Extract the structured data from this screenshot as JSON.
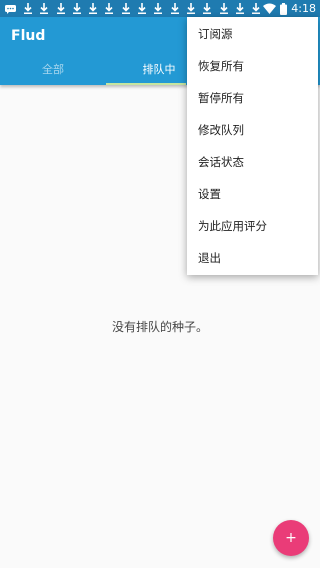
{
  "status_bar": {
    "time": "4:18",
    "left_icons": [
      "message-icon",
      "download-icon",
      "download-icon",
      "download-icon",
      "download-icon",
      "download-icon",
      "download-icon",
      "download-icon",
      "download-icon",
      "download-icon",
      "download-icon",
      "download-icon",
      "download-icon",
      "download-icon",
      "download-icon",
      "download-icon"
    ],
    "right_icons": [
      "wifi-icon",
      "battery-icon"
    ]
  },
  "app_bar": {
    "title": "Flud",
    "tabs": [
      {
        "label": "全部"
      },
      {
        "label": "排队中"
      }
    ],
    "active_tab": 1,
    "color": "#2399d4"
  },
  "empty_state": {
    "text": "没有排队的种子。"
  },
  "overflow_menu": {
    "items": [
      {
        "label": "订阅源"
      },
      {
        "label": "恢复所有"
      },
      {
        "label": "暂停所有"
      },
      {
        "label": "修改队列"
      },
      {
        "label": "会话状态"
      },
      {
        "label": "设置"
      },
      {
        "label": "为此应用评分"
      },
      {
        "label": "退出"
      }
    ]
  },
  "fab": {
    "label": "+",
    "color": "#ea3c78"
  }
}
